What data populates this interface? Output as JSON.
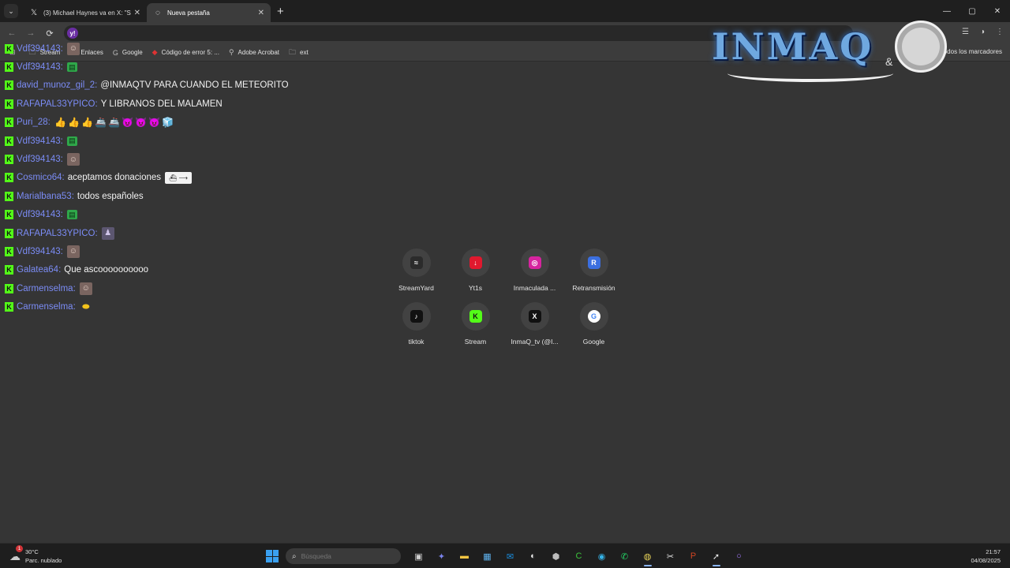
{
  "browser": {
    "tabs": [
      {
        "title": "(3) Michael Haynes va en X: \"Sp",
        "icon": "x-logo-icon",
        "active": false
      },
      {
        "title": "Nueva pestaña",
        "icon": "globe-icon",
        "active": true
      }
    ],
    "new_tab_symbol": "+",
    "window_controls": {
      "minimize": "—",
      "maximize": "▢",
      "close": "✕"
    }
  },
  "toolbar": {
    "back": "←",
    "forward": "→",
    "reload": "⟳",
    "omnibox_icon_letter": "y!",
    "omnibox_value": ""
  },
  "bookmarks": {
    "items": [
      {
        "label": "Stream",
        "icon": "folder-icon"
      },
      {
        "label": "Enlaces",
        "icon": "folder-icon"
      },
      {
        "label": "Google",
        "icon": "google-icon"
      },
      {
        "label": "Código de error 5: ...",
        "icon": "error-icon"
      },
      {
        "label": "Adobe Acrobat",
        "icon": "acrobat-icon"
      },
      {
        "label": "ext",
        "icon": "folder-icon"
      }
    ],
    "all_bookmarks": "odos los marcadores"
  },
  "logo": {
    "text": "INMAQ",
    "amp": "&"
  },
  "chat": {
    "messages": [
      {
        "user": "Vdf394143",
        "text": "",
        "emotes": [
          "face"
        ]
      },
      {
        "user": "Vdf394143",
        "text": "",
        "emotes": [
          "green"
        ]
      },
      {
        "user": "david_munoz_gil_2",
        "text": "@INMAQTV PARA CUANDO EL METEORITO",
        "emotes": []
      },
      {
        "user": "RAFAPAL33YPICO",
        "text": "Y LIBRANOS DEL MALAMEN",
        "emotes": []
      },
      {
        "user": "Puri_28",
        "text": "",
        "emotes": [
          "👍",
          "👍",
          "👍",
          "🚢",
          "🚢",
          "😈",
          "😈",
          "😈",
          "🧊"
        ]
      },
      {
        "user": "Vdf394143",
        "text": "",
        "emotes": [
          "green"
        ]
      },
      {
        "user": "Vdf394143",
        "text": "",
        "emotes": [
          "face"
        ]
      },
      {
        "user": "Cosmico64",
        "text": "aceptamos donaciones",
        "emotes": [
          "ship"
        ]
      },
      {
        "user": "Marialbana53",
        "text": "todos españoles",
        "emotes": []
      },
      {
        "user": "Vdf394143",
        "text": "",
        "emotes": [
          "green"
        ]
      },
      {
        "user": "RAFAPAL33YPICO",
        "text": "",
        "emotes": [
          "char"
        ]
      },
      {
        "user": "Vdf394143",
        "text": "",
        "emotes": [
          "face"
        ]
      },
      {
        "user": "Galatea64",
        "text": "Que ascoooooooooo",
        "emotes": []
      },
      {
        "user": "Carmenselma",
        "text": "",
        "emotes": [
          "face"
        ]
      },
      {
        "user": "Carmenselma",
        "text": "",
        "emotes": [
          "ball"
        ]
      }
    ]
  },
  "shortcuts": [
    {
      "label": "StreamYard",
      "icon": "streamyard-icon",
      "color": "#2b2b2b",
      "glyph": "≈"
    },
    {
      "label": "Yt1s",
      "icon": "download-icon",
      "color": "#e0192e",
      "glyph": "↓"
    },
    {
      "label": "Inmaculada ...",
      "icon": "instagram-icon",
      "color": "#d6249f",
      "glyph": "◎"
    },
    {
      "label": "Retransmisión",
      "icon": "restream-icon",
      "color": "#3b6fe0",
      "glyph": "R"
    },
    {
      "label": "tiktok",
      "icon": "tiktok-icon",
      "color": "#111111",
      "glyph": "♪"
    },
    {
      "label": "Stream",
      "icon": "kick-icon",
      "color": "#53fc18",
      "glyph": "K"
    },
    {
      "label": "InmaQ_tv (@I...",
      "icon": "x-logo-icon",
      "color": "#111111",
      "glyph": "X"
    },
    {
      "label": "Google",
      "icon": "google-icon",
      "color": "#ffffff",
      "glyph": "G"
    }
  ],
  "taskbar": {
    "weather_temp": "30°C",
    "weather_desc": "Parc. nublado",
    "weather_badge": "1",
    "search_placeholder": "Búsqueda",
    "apps": [
      {
        "name": "task-view-icon",
        "glyph": "▣",
        "color": "#cfcfcf"
      },
      {
        "name": "teams-icon",
        "glyph": "✦",
        "color": "#7b83eb"
      },
      {
        "name": "file-explorer-icon",
        "glyph": "▬",
        "color": "#f4c542"
      },
      {
        "name": "store-icon",
        "glyph": "▦",
        "color": "#5fb3f0"
      },
      {
        "name": "outlook-icon",
        "glyph": "✉",
        "color": "#1a8fe0"
      },
      {
        "name": "obs-icon",
        "glyph": "◐",
        "color": "#e8e8e8"
      },
      {
        "name": "app-icon",
        "glyph": "⬢",
        "color": "#bdbdbd"
      },
      {
        "name": "camtasia-icon",
        "glyph": "C",
        "color": "#3cc43c"
      },
      {
        "name": "edge-icon",
        "glyph": "◉",
        "color": "#35b2e6"
      },
      {
        "name": "whatsapp-icon",
        "glyph": "✆",
        "color": "#25d366"
      },
      {
        "name": "chrome-icon",
        "glyph": "◍",
        "color": "#e8d35a"
      },
      {
        "name": "capcut-icon",
        "glyph": "✂",
        "color": "#e0e0e0"
      },
      {
        "name": "powerpoint-icon",
        "glyph": "P",
        "color": "#d04423"
      },
      {
        "name": "pinned-app-icon",
        "glyph": "➚",
        "color": "#e8e8e8"
      },
      {
        "name": "circle-app-icon",
        "glyph": "○",
        "color": "#a77bff"
      }
    ],
    "time": "21:57",
    "date": "04/08/2025"
  }
}
